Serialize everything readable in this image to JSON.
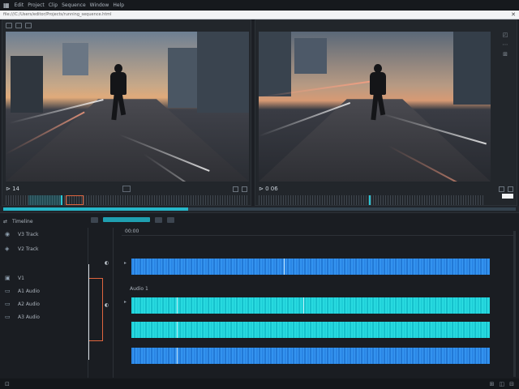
{
  "window": {
    "logo_glyph": "▦",
    "menu": [
      "Edit",
      "Project",
      "Clip",
      "Sequence",
      "Window",
      "Help"
    ],
    "url": "file:///C:/Users/editor/Projects/running_sequence.html",
    "close_glyph": "✕"
  },
  "source_viewer": {
    "timecode": "⊳ 14",
    "center_icon": "▢"
  },
  "program_viewer": {
    "timecode": "⊳ 0 06",
    "side_icons": [
      "◰",
      "⋯",
      "⊞"
    ]
  },
  "playback": {
    "progress": 0.36,
    "accent": "#26b6c8"
  },
  "timeline": {
    "header_label": "Timeline",
    "tracks": [
      {
        "icon": "◉",
        "label": "V3 Track"
      },
      {
        "icon": "◈",
        "label": "V2 Track"
      },
      {
        "icon": "▣",
        "label": "V1"
      },
      {
        "icon": "▭",
        "label": "A1 Audio"
      },
      {
        "icon": "▭",
        "label": "A2 Audio"
      },
      {
        "icon": "▭",
        "label": "A3 Audio"
      }
    ],
    "ruler_label": "00:00",
    "track_label_1": "Audio 1",
    "clip_colors": {
      "blue": "#2a86e6",
      "cyan": "#1fd1d9",
      "selection": "#e0653e"
    }
  },
  "status": {
    "left_icon": "⊡",
    "right_icons": [
      "⊞",
      "◫",
      "⊟"
    ]
  }
}
